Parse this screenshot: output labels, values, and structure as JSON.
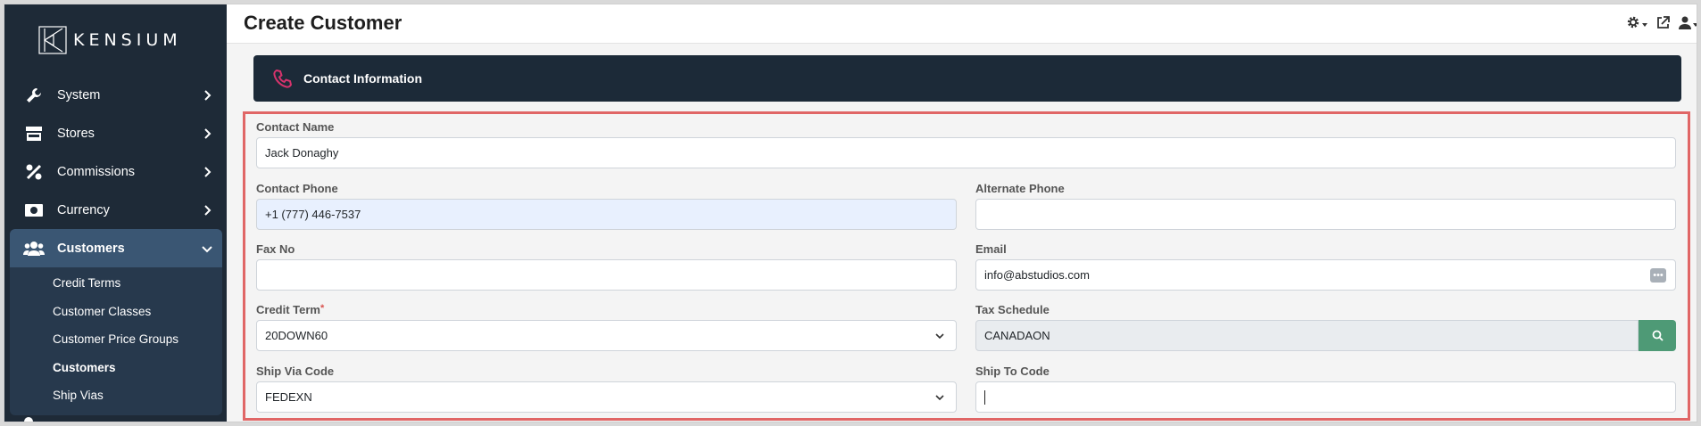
{
  "app": {
    "brand": "KENSIUM",
    "page_title": "Create Customer"
  },
  "sidebar": {
    "items": [
      {
        "label": "System",
        "icon": "wrench-icon"
      },
      {
        "label": "Stores",
        "icon": "store-icon"
      },
      {
        "label": "Commissions",
        "icon": "percent-icon"
      },
      {
        "label": "Currency",
        "icon": "money-icon"
      },
      {
        "label": "Customers",
        "icon": "users-icon"
      }
    ],
    "subitems": [
      {
        "label": "Credit Terms"
      },
      {
        "label": "Customer Classes"
      },
      {
        "label": "Customer Price Groups"
      },
      {
        "label": "Customers"
      },
      {
        "label": "Ship Vias"
      }
    ]
  },
  "header_icons": [
    "settings-icon",
    "external-link-icon",
    "user-icon"
  ],
  "section": {
    "title": "Contact Information",
    "icon": "phone-icon"
  },
  "form": {
    "contact_name": {
      "label": "Contact Name",
      "value": "Jack Donaghy"
    },
    "contact_phone": {
      "label": "Contact Phone",
      "value": "+1 (777) 446-7537"
    },
    "alternate_phone": {
      "label": "Alternate Phone",
      "value": ""
    },
    "fax_no": {
      "label": "Fax No",
      "value": ""
    },
    "email": {
      "label": "Email",
      "value": "info@abstudios.com"
    },
    "credit_term": {
      "label": "Credit Term",
      "required_mark": "*",
      "value": "20DOWN60"
    },
    "tax_schedule": {
      "label": "Tax Schedule",
      "value": "CANADAON"
    },
    "ship_via_code": {
      "label": "Ship Via Code",
      "value": "FEDEXN"
    },
    "ship_to_code": {
      "label": "Ship To Code",
      "value": ""
    }
  },
  "colors": {
    "sidebar_bg": "#1e2a37",
    "sidebar_active": "#3a5673",
    "header_bar": "#1c2a38",
    "accent_phone": "#d6336c",
    "highlight_border": "#e06666",
    "search_button": "#4e9a76"
  }
}
